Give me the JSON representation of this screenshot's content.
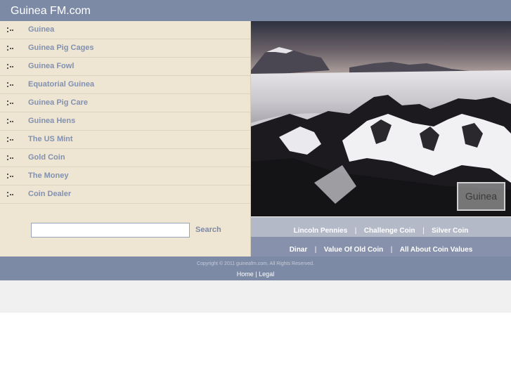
{
  "header": {
    "title": "Guinea FM.com"
  },
  "nav": {
    "items": [
      {
        "label": "Guinea"
      },
      {
        "label": "Guinea Pig Cages"
      },
      {
        "label": "Guinea Fowl"
      },
      {
        "label": "Equatorial Guinea"
      },
      {
        "label": "Guinea Pig Care"
      },
      {
        "label": "Guinea Hens"
      },
      {
        "label": "The US Mint"
      },
      {
        "label": "Gold Coin"
      },
      {
        "label": "The Money"
      },
      {
        "label": "Coin Dealer"
      }
    ]
  },
  "search": {
    "value": "",
    "placeholder": "",
    "button_label": "Search"
  },
  "photo": {
    "caption": "Guinea"
  },
  "links": {
    "row1": [
      "Lincoln Pennies",
      "Challenge Coin",
      "Silver Coin"
    ],
    "row2": [
      "Dinar",
      "Value Of Old Coin",
      "All About Coin Values"
    ],
    "separator": "|"
  },
  "footer": {
    "copyright": "Copyright © 2011 guineafm.com. All Rights Reserved.",
    "home_label": "Home",
    "separator": "|",
    "legal_label": "Legal"
  },
  "colors": {
    "header_bg": "#7d8aa6",
    "sidebar_bg": "#efe5d3",
    "link_text": "#8191b0"
  }
}
